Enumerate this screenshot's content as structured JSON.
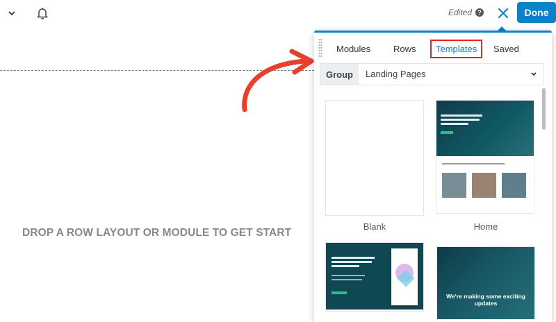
{
  "topbar": {
    "status": "Edited",
    "help_symbol": "?",
    "done_label": "Done",
    "icons": [
      "chevron-down-icon",
      "bell-icon",
      "help-icon",
      "close-icon"
    ],
    "accent": "#0a82c9"
  },
  "canvas": {
    "drop_text": "DROP A ROW LAYOUT OR MODULE TO GET START",
    "annotation_color": "#e8402e"
  },
  "panel": {
    "tabs": [
      {
        "label": "Modules",
        "active": false
      },
      {
        "label": "Rows",
        "active": false
      },
      {
        "label": "Templates",
        "active": true
      },
      {
        "label": "Saved",
        "active": false
      }
    ],
    "group_label": "Group",
    "group_select_value": "Landing Pages",
    "templates": [
      {
        "label": "Blank"
      },
      {
        "label": "Home"
      },
      {
        "label": ""
      },
      {
        "label": ""
      }
    ],
    "thumb_text": {
      "lower_right_heading": "We're making some exciting updates"
    }
  }
}
